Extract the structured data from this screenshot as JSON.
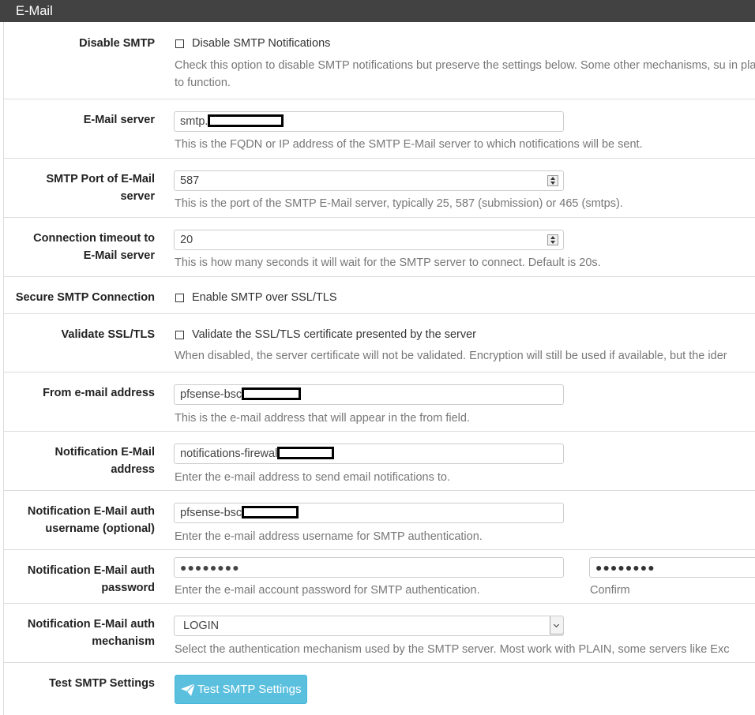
{
  "section": {
    "title": "E-Mail"
  },
  "disable_smtp": {
    "label": "Disable SMTP",
    "checkbox_label": "Disable SMTP Notifications",
    "checked": false,
    "help": "Check this option to disable SMTP notifications but preserve the settings below. Some other mechanisms, su in place to function."
  },
  "email_server": {
    "label": "E-Mail server",
    "value": "smtp.",
    "help": "This is the FQDN or IP address of the SMTP E-Mail server to which notifications will be sent."
  },
  "smtp_port": {
    "label_line1": "SMTP Port of E-Mail",
    "label_line2": "server",
    "value": "587",
    "help": "This is the port of the SMTP E-Mail server, typically 25, 587 (submission) or 465 (smtps)."
  },
  "timeout": {
    "label_line1": "Connection timeout to",
    "label_line2": "E-Mail server",
    "value": "20",
    "help": "This is how many seconds it will wait for the SMTP server to connect. Default is 20s."
  },
  "secure_smtp": {
    "label": "Secure SMTP Connection",
    "checkbox_label": "Enable SMTP over SSL/TLS",
    "checked": false
  },
  "validate_ssl": {
    "label": "Validate SSL/TLS",
    "checkbox_label": "Validate the SSL/TLS certificate presented by the server",
    "checked": false,
    "help": "When disabled, the server certificate will not be validated. Encryption will still be used if available, but the ider"
  },
  "from_address": {
    "label": "From e-mail address",
    "value": "pfsense-bsc",
    "help": "This is the e-mail address that will appear in the from field."
  },
  "notification_address": {
    "label_line1": "Notification E-Mail",
    "label_line2": "address",
    "value": "notifications-firewal",
    "help": "Enter the e-mail address to send email notifications to."
  },
  "auth_username": {
    "label_line1": "Notification E-Mail auth",
    "label_line2": "username (optional)",
    "value": "pfsense-bsc",
    "help": "Enter the e-mail address username for SMTP authentication."
  },
  "auth_password": {
    "label_line1": "Notification E-Mail auth",
    "label_line2": "password",
    "value": "●●●●●●●●",
    "confirm_value": "●●●●●●●●",
    "help": "Enter the e-mail account password for SMTP authentication.",
    "confirm_label": "Confirm"
  },
  "auth_mechanism": {
    "label_line1": "Notification E-Mail auth",
    "label_line2": "mechanism",
    "value": "LOGIN",
    "help": "Select the authentication mechanism used by the SMTP server. Most work with PLAIN, some servers like Exc"
  },
  "test_smtp": {
    "label": "Test SMTP Settings",
    "button_label": "Test SMTP Settings",
    "button_color": "#5bc0de"
  }
}
